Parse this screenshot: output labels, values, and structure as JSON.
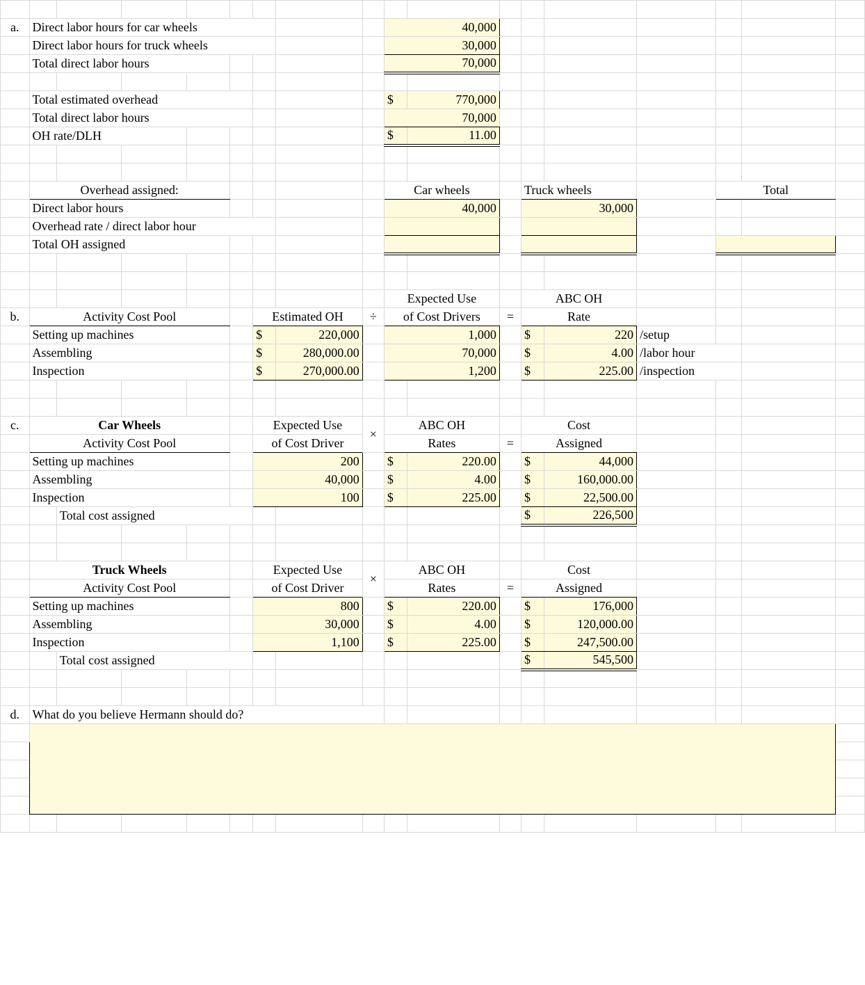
{
  "a": {
    "marker": "a.",
    "r1_label": "Direct labor hours for car wheels",
    "r1_val": "40,000",
    "r2_label": "Direct labor hours for truck wheels",
    "r2_val": "30,000",
    "r3_label": "Total direct labor hours",
    "r3_val": "70,000",
    "r4_label": "Total estimated overhead",
    "r4_cur": "$",
    "r4_val": "770,000",
    "r5_label": "Total direct labor hours",
    "r5_val": "70,000",
    "r6_label": "OH rate/DLH",
    "r6_cur": "$",
    "r6_val": "11.00",
    "oa_label": "Overhead assigned:",
    "oa_col1": "Car wheels",
    "oa_col2": "Truck wheels",
    "oa_col3": "Total",
    "dlh_label": "Direct labor hours",
    "dlh_car": "40,000",
    "dlh_truck": "30,000",
    "rate_label": "Overhead rate / direct labor hour",
    "total_label": "Total OH assigned"
  },
  "b": {
    "marker": "b.",
    "h1": "Activity Cost Pool",
    "h2": "Estimated OH",
    "div": "÷",
    "h3a": "Expected Use",
    "h3b": "of Cost Drivers",
    "eq": "=",
    "h4a": "ABC OH",
    "h4b": "Rate",
    "rows": [
      {
        "name": "Setting up machines",
        "cur": "$",
        "est": "220,000",
        "use": "1,000",
        "rcur": "$",
        "rate": "220",
        "unit": "/setup"
      },
      {
        "name": "Assembling",
        "cur": "$",
        "est": "280,000.00",
        "use": "70,000",
        "rcur": "$",
        "rate": "4.00",
        "unit": "/labor hour"
      },
      {
        "name": "Inspection",
        "cur": "$",
        "est": "270,000.00",
        "use": "1,200",
        "rcur": "$",
        "rate": "225.00",
        "unit": "/inspection"
      }
    ]
  },
  "c": {
    "marker": "c.",
    "title_car": "Car Wheels",
    "title_truck": "Truck Wheels",
    "h_acp": "Activity Cost Pool",
    "h_eu1": "Expected Use",
    "h_eu2": "of Cost Driver",
    "times": "×",
    "h_abc1": "ABC OH",
    "h_abc2": "Rates",
    "eq": "=",
    "h_cost1": "Cost",
    "h_cost2": "Assigned",
    "car": {
      "rows": [
        {
          "name": "Setting up machines",
          "use": "200",
          "rcur": "$",
          "rate": "220.00",
          "ccur": "$",
          "cost": "44,000"
        },
        {
          "name": "Assembling",
          "use": "40,000",
          "rcur": "$",
          "rate": "4.00",
          "ccur": "$",
          "cost": "160,000.00"
        },
        {
          "name": "Inspection",
          "use": "100",
          "rcur": "$",
          "rate": "225.00",
          "ccur": "$",
          "cost": "22,500.00"
        }
      ],
      "total_label": "Total cost assigned",
      "total_cur": "$",
      "total_val": "226,500"
    },
    "truck": {
      "rows": [
        {
          "name": "Setting up machines",
          "use": "800",
          "rcur": "$",
          "rate": "220.00",
          "ccur": "$",
          "cost": "176,000"
        },
        {
          "name": "Assembling",
          "use": "30,000",
          "rcur": "$",
          "rate": "4.00",
          "ccur": "$",
          "cost": "120,000.00"
        },
        {
          "name": "Inspection",
          "use": "1,100",
          "rcur": "$",
          "rate": "225.00",
          "ccur": "$",
          "cost": "247,500.00"
        }
      ],
      "total_label": "Total cost assigned",
      "total_cur": "$",
      "total_val": "545,500"
    }
  },
  "d": {
    "marker": "d.",
    "question": "What do you believe Hermann should do?"
  }
}
